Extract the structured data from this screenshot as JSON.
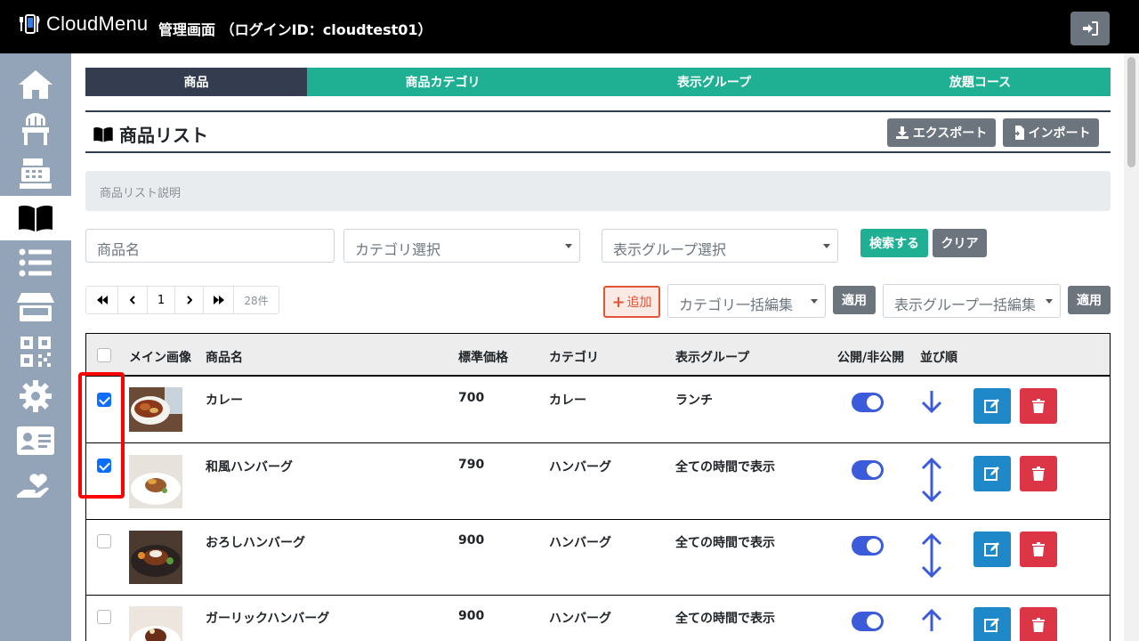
{
  "header": {
    "brand": "CloudMenu",
    "title": "管理画面 （ログインID：cloudtest01）",
    "logout_icon": "logout-icon"
  },
  "sidebar": {
    "items": [
      {
        "icon": "home-icon"
      },
      {
        "icon": "chair-icon"
      },
      {
        "icon": "cash-register-icon"
      },
      {
        "icon": "book-open-icon",
        "active": true
      },
      {
        "icon": "list-icon"
      },
      {
        "icon": "store-icon"
      },
      {
        "icon": "qrcode-icon"
      },
      {
        "icon": "gear-icon"
      },
      {
        "icon": "id-card-icon"
      },
      {
        "icon": "hand-heart-icon"
      }
    ]
  },
  "tabs": [
    {
      "label": "商品",
      "active": true
    },
    {
      "label": "商品カテゴリ"
    },
    {
      "label": "表示グループ"
    },
    {
      "label": "放題コース"
    }
  ],
  "section": {
    "title": "商品リスト",
    "export_label": "エクスポート",
    "import_label": "インポート",
    "description": "商品リスト説明"
  },
  "search": {
    "name_placeholder": "商品名",
    "category_select": "カテゴリ選択",
    "group_select": "表示グループ選択",
    "search_label": "検索する",
    "clear_label": "クリア"
  },
  "pagination": {
    "first": "«",
    "prev": "‹",
    "page": "1",
    "next": "›",
    "last": "»",
    "count": "28件"
  },
  "bulk": {
    "add_label": "追加",
    "category_bulk": "カテゴリ一括編集",
    "apply_label": "適用",
    "group_bulk": "表示グループ一括編集",
    "apply2_label": "適用"
  },
  "table": {
    "headers": {
      "image": "メイン画像",
      "name": "商品名",
      "price": "標準価格",
      "category": "カテゴリ",
      "group": "表示グループ",
      "public": "公開/非公開",
      "order": "並び順"
    },
    "rows": [
      {
        "checked": true,
        "name": "カレー",
        "price": "700",
        "category": "カレー",
        "group": "ランチ",
        "public": true
      },
      {
        "checked": true,
        "name": "和風ハンバーグ",
        "price": "790",
        "category": "ハンバーグ",
        "group": "全ての時間で表示",
        "public": true
      },
      {
        "checked": false,
        "name": "おろしハンバーグ",
        "price": "900",
        "category": "ハンバーグ",
        "group": "全ての時間で表示",
        "public": true
      },
      {
        "checked": false,
        "name": "ガーリックハンバーグ",
        "price": "900",
        "category": "ハンバーグ",
        "group": "全ての時間で表示",
        "public": true
      }
    ]
  },
  "colors": {
    "tab_active": "#333d4f",
    "tab": "#1fb094",
    "sidebar": "#94a4b8",
    "toggle_on": "#3b5bdb",
    "edit": "#1e88c8",
    "delete": "#dc3545",
    "highlight": "#ff0000"
  }
}
